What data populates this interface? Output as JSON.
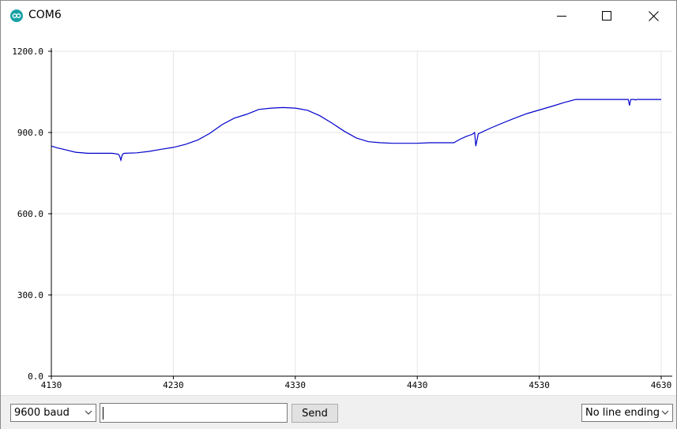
{
  "window": {
    "title": "COM6",
    "icon": "arduino-icon",
    "controls": {
      "minimize": "minimize-icon",
      "maximize": "maximize-icon",
      "close": "close-icon"
    }
  },
  "chart_data": {
    "type": "line",
    "title": "",
    "xlabel": "",
    "ylabel": "",
    "xlim": [
      4130,
      4630
    ],
    "ylim": [
      0,
      1200
    ],
    "grid": true,
    "x_ticks": [
      "4130",
      "4230",
      "4330",
      "4430",
      "4530",
      "4630"
    ],
    "y_ticks": [
      "0.0",
      "300.0",
      "600.0",
      "900.0",
      "1200.0"
    ],
    "x_tick_values": [
      4130,
      4230,
      4330,
      4430,
      4530,
      4630
    ],
    "y_tick_values": [
      0,
      300,
      600,
      900,
      1200
    ],
    "line_color": "#0000cc",
    "series": [
      {
        "x": [
          4130,
          4135,
          4140,
          4150,
          4160,
          4170,
          4180,
          4185,
          4186,
          4187,
          4188,
          4189,
          4190,
          4200,
          4210,
          4220,
          4230,
          4240,
          4250,
          4260,
          4270,
          4280,
          4290,
          4300,
          4310,
          4320,
          4330,
          4340,
          4350,
          4360,
          4370,
          4380,
          4390,
          4400,
          4410,
          4420,
          4430,
          4440,
          4450,
          4460,
          4465,
          4470,
          4475,
          4477,
          4478,
          4480,
          4490,
          4500,
          4510,
          4520,
          4530,
          4540,
          4550,
          4560,
          4570,
          4580,
          4585,
          4586,
          4587,
          4590,
          4595,
          4597,
          4598,
          4602,
          4603,
          4604,
          4605,
          4606,
          4608,
          4609,
          4610,
          4612,
          4614,
          4616,
          4620,
          4625,
          4630
        ],
        "y": [
          850,
          843,
          838,
          827,
          823,
          823,
          823,
          820,
          812,
          798,
          816,
          822,
          823,
          825,
          830,
          838,
          845,
          856,
          872,
          897,
          929,
          953,
          967,
          985,
          990,
          992,
          990,
          982,
          962,
          935,
          905,
          880,
          866,
          862,
          860,
          860,
          860,
          862,
          862,
          862,
          875,
          885,
          893,
          900,
          850,
          895,
          916,
          935,
          953,
          970,
          983,
          996,
          1010,
          1022,
          1022,
          1022,
          1022,
          1022,
          1022,
          1022,
          1022,
          1022,
          1022,
          1022,
          1022,
          1000,
          1022,
          1022,
          1022,
          1020,
          1022,
          1022,
          1022,
          1022,
          1022,
          1022,
          1022
        ]
      }
    ]
  },
  "bottom": {
    "baud": "9600 baud",
    "input_value": "",
    "send_label": "Send",
    "line_ending": "No line ending"
  }
}
